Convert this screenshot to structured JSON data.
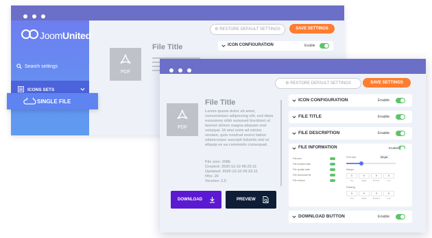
{
  "back": {
    "brand": {
      "part1": "Joom",
      "part2": "United"
    },
    "search_label": "Search settings",
    "icons_sets": "ICONS SETS",
    "single_file": "SINGLE FILE",
    "restore": "RESTORE DEFAULT SETTINGS",
    "save": "SAVE SETTINGS",
    "preview_title": "File Title",
    "pdf": "PDF",
    "icon_config": "ICON CONFIGURATION",
    "enable": "Enable"
  },
  "front": {
    "restore": "RESTORE DEFAULT SETTINGS",
    "save": "SAVE SETTINGS",
    "pdf": "PDF",
    "title": "File Title",
    "description": "Lorem ipsum dolor sit amet, consectetuer adipiscing elit, sed diam nonummy nibh euismod tincidunt ut laoreet dolore magna aliquam erat volutpat. Ut wisi enim ad minim veniam, quis nostrud exerci tation ullamcorper suscipit lobortis nisl ut aliquip ex ea commodo consequat.",
    "meta": {
      "size": "File size: 208b",
      "created": "Created: 2020-12-10 09:23:11",
      "updated": "Updated: 2020-12-10 09:23:11",
      "hits": "Hits: 20",
      "version": "Version: 2.0"
    },
    "download": "DOWNLOAD",
    "preview": "PREVIEW",
    "sections": [
      {
        "label": "ICON CONFIGURATION",
        "enable": "Enable"
      },
      {
        "label": "FILE TITLE",
        "enable": "Enable"
      },
      {
        "label": "FILE DESCRIPTION",
        "enable": "Enable"
      }
    ],
    "file_info": {
      "label": "FILE INFORMATION",
      "enable": "Enable",
      "checks": [
        "File size",
        "File created date",
        "File update date",
        "File download hit",
        "File version"
      ],
      "font_size_label": "Font size",
      "font_size_value": "14",
      "font_size_unit": "px",
      "font_size_fraction": 0.3,
      "margin_label": "Margin",
      "padding_label": "Padding",
      "box_values": [
        "0",
        "0",
        "0",
        "0"
      ],
      "box_labels": [
        "Top",
        "Right",
        "Bottom",
        "Left"
      ]
    },
    "download_button": {
      "label": "DOWNLOAD BUTTON",
      "enable": "Enable"
    }
  },
  "colors": {
    "accent_purple": "#6b6fc8",
    "orange": "#ff7d2e",
    "toggle_green": "#5ec46b",
    "download_purple": "#5b1ad1",
    "preview_navy": "#0f1e36"
  }
}
